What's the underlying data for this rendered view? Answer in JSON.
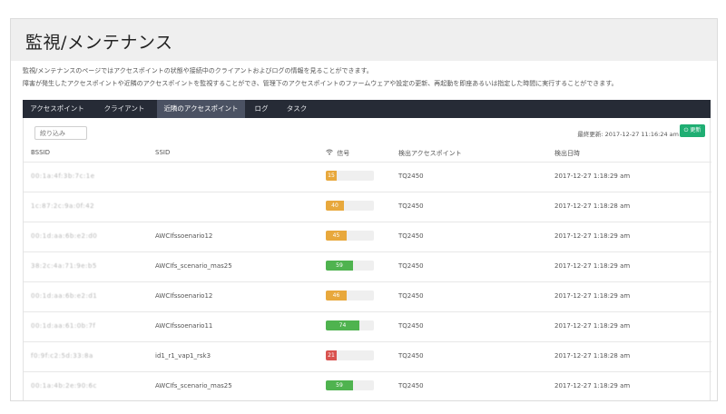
{
  "page": {
    "title": "監視/メンテナンス",
    "description_line1": "監視/メンテナンスのページではアクセスポイントの状態や接続中のクライアントおよびログの情報を見ることができます。",
    "description_line2": "障害が発生したアクセスポイントや近隣のアクセスポイントを監視することができ、管理下のアクセスポイントのファームウェアや設定の更新、再起動を即座あるいは指定した時間に実行することができます。"
  },
  "tabs": [
    {
      "label": "アクセスポイント",
      "active": false
    },
    {
      "label": "クライアント",
      "active": false
    },
    {
      "label": "近隣のアクセスポイント",
      "active": true
    },
    {
      "label": "ログ",
      "active": false
    },
    {
      "label": "タスク",
      "active": false
    }
  ],
  "toolbar": {
    "filter_placeholder": "絞り込み",
    "last_updated": "最終更新: 2017-12-27 11:16:24 am",
    "refresh_label": "⏻ 更新"
  },
  "table": {
    "headers": {
      "bssid": "BSSID",
      "ssid": "SSID",
      "signal": "信号",
      "detected_ap": "検出アクセスポイント",
      "detected_time": "検出日時"
    },
    "rows": [
      {
        "bssid": "00:1a:4f:3b:7c:1e",
        "ssid": "",
        "signal": 15,
        "signal_color": "#e8a83c",
        "ap": "TQ2450",
        "time": "2017-12-27 1:18:29 am"
      },
      {
        "bssid": "1c:87:2c:9a:0f:42",
        "ssid": "",
        "signal": 40,
        "signal_color": "#e8a83c",
        "ap": "TQ2450",
        "time": "2017-12-27 1:18:28 am"
      },
      {
        "bssid": "00:1d:aa:6b:e2:d0",
        "ssid": "AWCIfssoenario12",
        "signal": 45,
        "signal_color": "#e8a83c",
        "ap": "TQ2450",
        "time": "2017-12-27 1:18:29 am"
      },
      {
        "bssid": "38:2c:4a:71:9e:b5",
        "ssid": "AWCIfs_scenario_mas25",
        "signal": 59,
        "signal_color": "#4fb34f",
        "ap": "TQ2450",
        "time": "2017-12-27 1:18:29 am"
      },
      {
        "bssid": "00:1d:aa:6b:e2:d1",
        "ssid": "AWCIfssoenario12",
        "signal": 46,
        "signal_color": "#e8a83c",
        "ap": "TQ2450",
        "time": "2017-12-27 1:18:29 am"
      },
      {
        "bssid": "00:1d:aa:61:0b:7f",
        "ssid": "AWCIfssoenario11",
        "signal": 74,
        "signal_color": "#4fb34f",
        "ap": "TQ2450",
        "time": "2017-12-27 1:18:29 am"
      },
      {
        "bssid": "f0:9f:c2:5d:33:8a",
        "ssid": "id1_r1_vap1_rsk3",
        "signal": 21,
        "signal_color": "#d9534f",
        "ap": "TQ2450",
        "time": "2017-12-27 1:18:28 am"
      },
      {
        "bssid": "00:1a:4b:2e:90:6c",
        "ssid": "AWCIfs_scenario_mas25",
        "signal": 59,
        "signal_color": "#4fb34f",
        "ap": "TQ2450",
        "time": "2017-12-27 1:18:29 am"
      }
    ]
  }
}
